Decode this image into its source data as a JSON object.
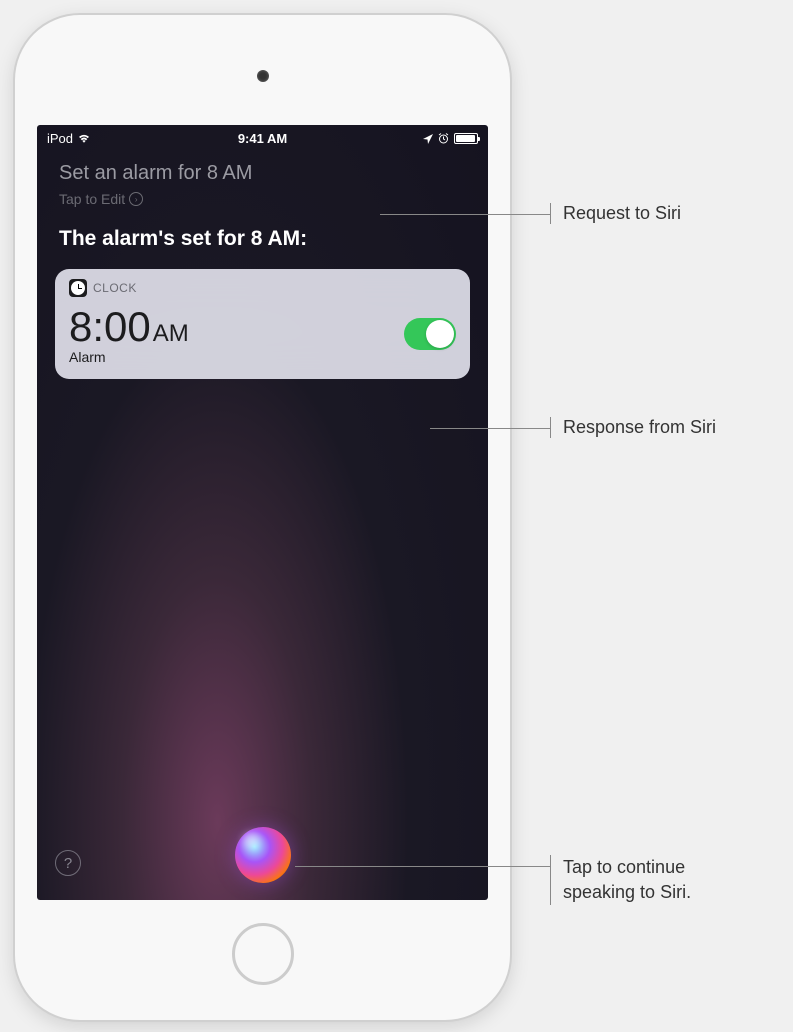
{
  "status_bar": {
    "carrier": "iPod",
    "time": "9:41 AM"
  },
  "siri": {
    "user_request": "Set an alarm for 8 AM",
    "tap_to_edit": "Tap to Edit",
    "response": "The alarm's set for 8 AM:"
  },
  "clock_card": {
    "app_name": "CLOCK",
    "time": "8:00",
    "ampm": "AM",
    "label": "Alarm",
    "toggle_on": true
  },
  "help_symbol": "?",
  "callouts": {
    "request": "Request to Siri",
    "response": "Response from Siri",
    "continue": "Tap to continue speaking to Siri."
  }
}
